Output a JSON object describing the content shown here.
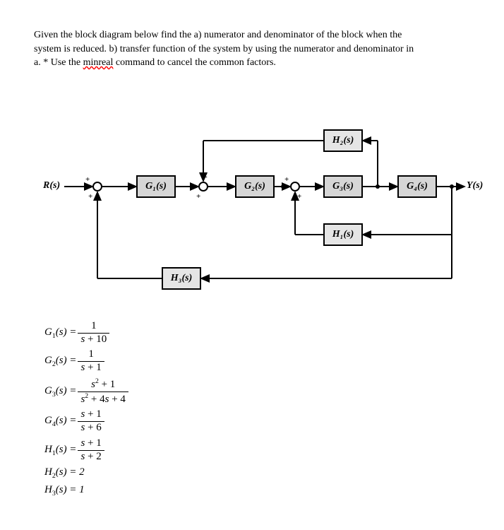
{
  "prompt": {
    "line1a": "Given the block diagram below find the a) numerator and denominator of the block when the",
    "line2a": "system is reduced. b) transfer function of the system by using the numerator and denominator in",
    "line3a": "a. * Use the ",
    "line3_cmd": "minreal",
    "line3b": " command to cancel the common factors."
  },
  "labels": {
    "R": "R(s)",
    "Y": "Y(s)",
    "G1": "G₁(s)",
    "G2": "G₂(s)",
    "G3": "G₃(s)",
    "G4": "G₄(s)",
    "H1": "H₁(s)",
    "H2": "H₂(s)",
    "H3": "H₃(s)",
    "plus": "+",
    "minus": "-"
  },
  "equations": {
    "G1": {
      "lhs": "G₁(s) = ",
      "num": "1",
      "den": "s + 10"
    },
    "G2": {
      "lhs": "G₂(s) = ",
      "num": "1",
      "den": "s + 1"
    },
    "G3": {
      "lhs": "G₃(s) = ",
      "num": "s² + 1",
      "den": "s² + 4s + 4"
    },
    "G4": {
      "lhs": "G₄(s) = ",
      "num": "s + 1",
      "den": "s + 6"
    },
    "H1": {
      "lhs": "H₁(s) = ",
      "num": "s + 1",
      "den": "s + 2"
    },
    "H2": {
      "lhs": "H₂(s) = 2",
      "num": "",
      "den": ""
    },
    "H3": {
      "lhs": "H₃(s) = 1",
      "num": "",
      "den": ""
    }
  }
}
